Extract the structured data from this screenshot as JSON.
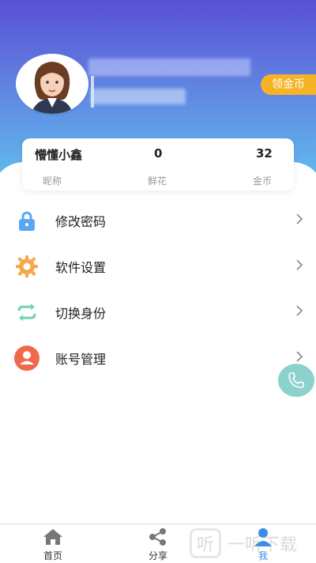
{
  "profile": {
    "coin_button": "领金币"
  },
  "stats": {
    "nickname_value": "懵懂小鑫",
    "nickname_label": "昵称",
    "flowers_value": "0",
    "flowers_label": "鲜花",
    "coins_value": "32",
    "coins_label": "金币"
  },
  "menu": {
    "items": [
      {
        "label": "修改密码",
        "icon": "lock-icon",
        "color": "#5aa6f5"
      },
      {
        "label": "软件设置",
        "icon": "gear-icon",
        "color": "#f4a94b"
      },
      {
        "label": "切换身份",
        "icon": "swap-icon",
        "color": "#6fd0b3"
      },
      {
        "label": "账号管理",
        "icon": "user-icon",
        "color": "#ef6a4c"
      }
    ]
  },
  "tabbar": {
    "home": "首页",
    "share": "分享",
    "me": "我"
  },
  "watermark": {
    "text": "一听下载"
  },
  "colors": {
    "accent": "#3a8ee6",
    "coin": "#f6b325"
  }
}
